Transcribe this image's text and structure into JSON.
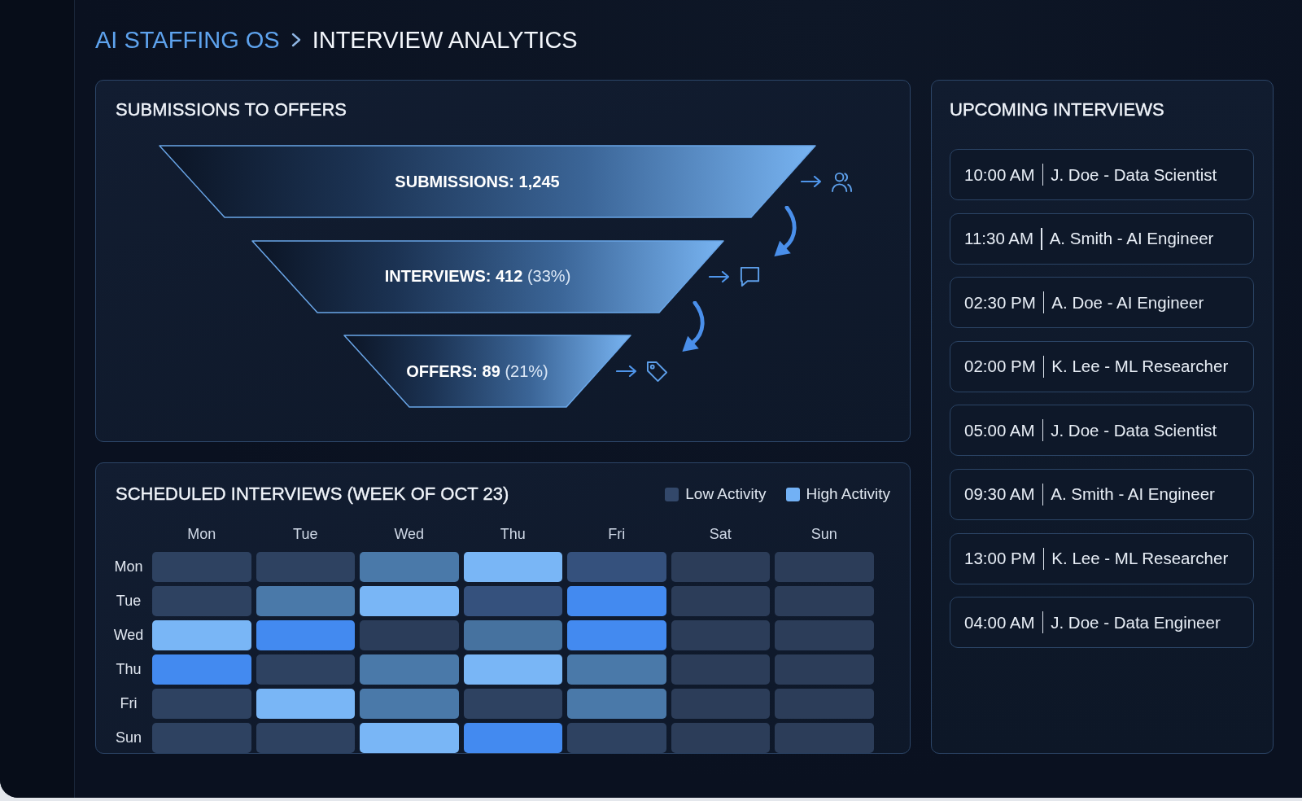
{
  "breadcrumb": {
    "parent": "AI STAFFING OS",
    "current": "INTERVIEW ANALYTICS"
  },
  "submissions_to_offers": {
    "title": "SUBMISSIONS TO OFFERS",
    "stages": [
      {
        "label": "SUBMISSIONS: 1,245"
      },
      {
        "label": "INTERVIEWS: 412",
        "percent": "(33%)"
      },
      {
        "label": "OFFERS: 89",
        "percent": "(21%)"
      }
    ]
  },
  "scheduled_interviews": {
    "title": "SCHEDULED INTERVIEWS (WEEK OF OCT 23)",
    "legend": [
      {
        "label": "Low Activity",
        "color": "#33486a"
      },
      {
        "label": "High Activity",
        "color": "#72b1f5"
      }
    ],
    "columns": [
      "Mon",
      "Tue",
      "Wed",
      "Thu",
      "Fri",
      "Sat",
      "Sun"
    ],
    "rows": [
      {
        "label": "Mon",
        "cells": [
          {
            "color": "#2e4261"
          },
          {
            "color": "#2e4261"
          },
          {
            "color": "#4a79a9"
          },
          {
            "color": "#79b6f6"
          },
          {
            "color": "#35517d"
          },
          {
            "color": "#2c3d59"
          },
          {
            "color": "#2c3d59"
          }
        ]
      },
      {
        "label": "Tue",
        "cells": [
          {
            "color": "#2e4261"
          },
          {
            "color": "#4a79a9"
          },
          {
            "color": "#79b6f6"
          },
          {
            "color": "#35517d"
          },
          {
            "color": "#438af0"
          },
          {
            "color": "#2c3d59"
          },
          {
            "color": "#2c3d59"
          }
        ]
      },
      {
        "label": "Wed",
        "cells": [
          {
            "color": "#79b6f6"
          },
          {
            "color": "#438af0"
          },
          {
            "color": "#2b3d5a"
          },
          {
            "color": "#46729f"
          },
          {
            "color": "#438af0"
          },
          {
            "color": "#2c3d59"
          },
          {
            "color": "#2c3d59"
          }
        ]
      },
      {
        "label": "Thu",
        "cells": [
          {
            "color": "#438af0"
          },
          {
            "color": "#2e4261"
          },
          {
            "color": "#4a79a9"
          },
          {
            "color": "#79b6f6"
          },
          {
            "color": "#4a79a9"
          },
          {
            "color": "#2c3d59"
          },
          {
            "color": "#2c3d59"
          }
        ]
      },
      {
        "label": "Fri",
        "cells": [
          {
            "color": "#2e4261"
          },
          {
            "color": "#79b6f6"
          },
          {
            "color": "#4a79a9"
          },
          {
            "color": "#2e4261"
          },
          {
            "color": "#4a79a9"
          },
          {
            "color": "#2c3d59"
          },
          {
            "color": "#2c3d59"
          }
        ]
      },
      {
        "label": "Sun",
        "cells": [
          {
            "color": "#2e4261"
          },
          {
            "color": "#2e4261"
          },
          {
            "color": "#79b6f6"
          },
          {
            "color": "#438af0"
          },
          {
            "color": "#2e4261"
          },
          {
            "color": "#2c3d59"
          },
          {
            "color": "#2c3d59"
          }
        ]
      }
    ]
  },
  "upcoming_interviews": {
    "title": "UPCOMING INTERVIEWS",
    "items": [
      {
        "time": "10:00 AM",
        "detail": "J. Doe - Data Scientist"
      },
      {
        "time": "11:30 AM",
        "detail": "A. Smith - AI Engineer"
      },
      {
        "time": "02:30 PM",
        "detail": "A. Doe - AI Engineer"
      },
      {
        "time": "02:00 PM",
        "detail": "K. Lee - ML Researcher"
      },
      {
        "time": "05:00 AM",
        "detail": "J. Doe - Data Scientist"
      },
      {
        "time": "09:30 AM",
        "detail": "A. Smith - AI Engineer"
      },
      {
        "time": "13:00 PM",
        "detail": "K. Lee - ML Researcher"
      },
      {
        "time": "04:00 AM",
        "detail": "J. Doe - Data Engineer"
      }
    ]
  }
}
